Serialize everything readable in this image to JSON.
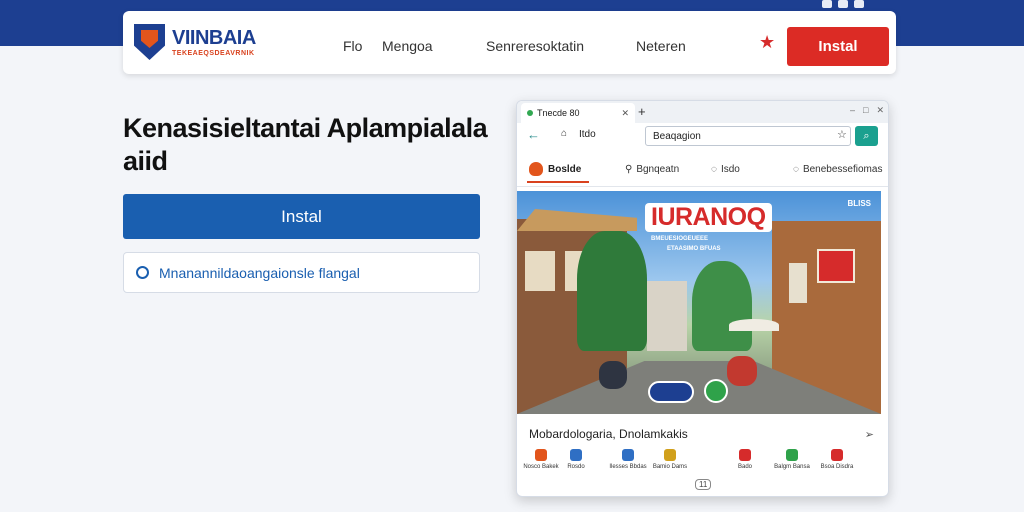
{
  "header": {
    "logo_title": "VIINBAIA",
    "logo_subtitle": "TEKEAEQSDEAVRNIK",
    "nav_links": [
      "Flo",
      "Mengoa",
      "Senreresoktatin",
      "Neteren"
    ],
    "install_label": "Instal"
  },
  "hero": {
    "title": "Kenasisieltantai Aplampialala aiid",
    "install_label": "Instal",
    "info_text": "Mnanannildaoangaionsle flangal"
  },
  "browser": {
    "tab_title": "Tnecde 80",
    "address_domain": "Itdo",
    "address_value": "Beaqagion",
    "site_brand": "Boslde",
    "site_links": [
      "Bgnqeatn",
      "Isdo",
      "Benebessefiomas"
    ],
    "banner_title": "IURANOQ",
    "banner_line1": "BMEUESIOGEUEEE",
    "banner_line2": "ETAASIMO BFUAS",
    "corner_tag": "BLISS",
    "caption": "Mobardologaria, Dnolamkakis",
    "pager": "11",
    "categories": [
      {
        "label": "Nosco Bakek",
        "color": "#e2551c"
      },
      {
        "label": "Rosdo",
        "color": "#2f6fc4"
      },
      {
        "label": "Ilesses Bbdas",
        "color": "#2f6fc4"
      },
      {
        "label": "Bamio Dams",
        "color": "#d1a01b"
      },
      {
        "label": "Bado",
        "color": "#d62b2b"
      },
      {
        "label": "Balgm Bansa",
        "color": "#2fa24a"
      },
      {
        "label": "Bsoa Disdra",
        "color": "#d62b2b"
      }
    ]
  },
  "colors": {
    "brand_blue": "#1d3f91",
    "install_red": "#dc2b25",
    "install_blue": "#1a5fb0",
    "accent_teal": "#1aa08f"
  }
}
